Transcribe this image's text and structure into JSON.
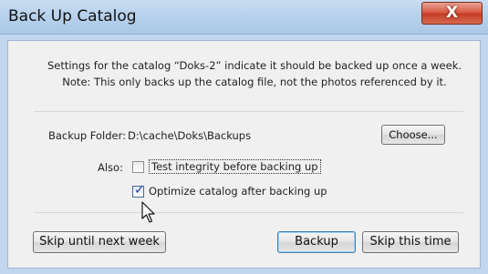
{
  "window": {
    "title": "Back Up Catalog",
    "close_icon": "close-icon",
    "close_label": "X"
  },
  "message": {
    "line1": "Settings for the catalog “Doks-2” indicate it should be backed up once a week.",
    "line2": "Note: This only backs up the catalog file, not the photos referenced by it."
  },
  "backup_folder": {
    "label": "Backup Folder:",
    "value": "D:\\cache\\Doks\\Backups",
    "choose_label": "Choose..."
  },
  "options": {
    "also_label": "Also:",
    "test_integrity": {
      "label": "Test integrity before backing up",
      "checked": false
    },
    "optimize": {
      "label": "Optimize catalog after backing up",
      "checked": true
    }
  },
  "buttons": {
    "skip_week": "Skip until next week",
    "backup": "Backup",
    "skip_time": "Skip this time"
  },
  "colors": {
    "titlebar": "#b8d2ec",
    "close_button": "#d7533b",
    "dialog_bg": "#f0f0f0"
  },
  "cursor_icon": "arrow-pointer-icon"
}
